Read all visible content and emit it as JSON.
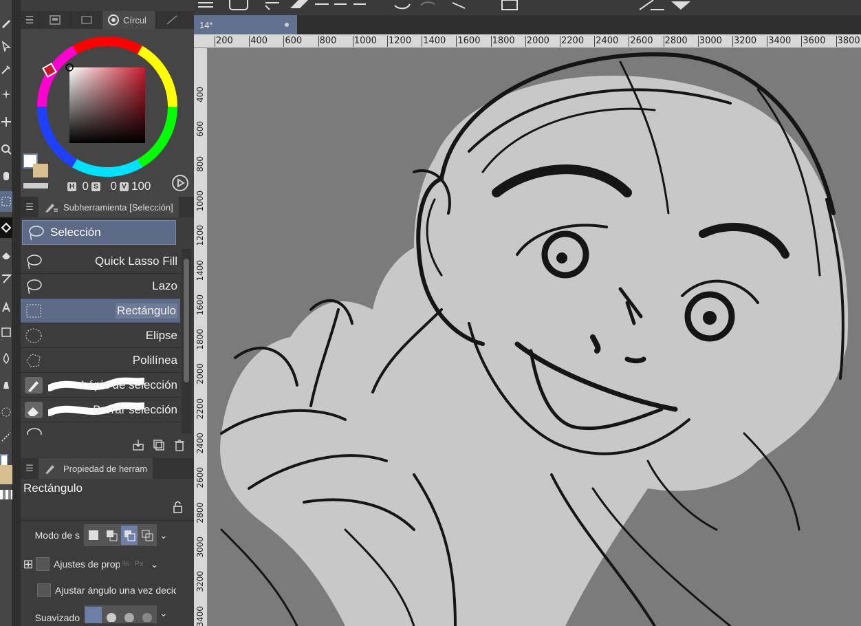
{
  "color_panel": {
    "tab_label": "Círcul",
    "hsv": {
      "h_label": "H",
      "h_value": "0",
      "s_label": "S",
      "s_value": "0",
      "v_label": "V",
      "v_value": "100"
    },
    "colors": {
      "main": "#ffffff",
      "sub": "#d8be8f",
      "hue": "#c51b2c"
    }
  },
  "subtool": {
    "panel_title": "Subherramienta [Selección]",
    "group_label": "Selección",
    "items": [
      {
        "label": "Quick Lasso Fill"
      },
      {
        "label": "Lazo"
      },
      {
        "label": "Rectángulo"
      },
      {
        "label": "Elipse"
      },
      {
        "label": "Polilínea"
      },
      {
        "label": "Lápiz de selección"
      },
      {
        "label": "Borrar selección"
      }
    ]
  },
  "tool_property": {
    "panel_title": "Propiedad de herram",
    "tool_name": "Rectángulo",
    "rows": [
      {
        "label": "Modo de s"
      },
      {
        "label": "Ajustes de propi"
      },
      {
        "label": "Ajustar ángulo una vez decidi"
      },
      {
        "label": "Suavizado"
      }
    ]
  },
  "document": {
    "tab_title": "14*"
  },
  "ruler": {
    "horizontal_ticks": [
      "200",
      "400",
      "600",
      "800",
      "1000",
      "1200",
      "1400",
      "1600",
      "1800",
      "2000",
      "2200",
      "2400",
      "2600",
      "2800",
      "3000",
      "3200",
      "3400",
      "3600",
      "3800"
    ],
    "vertical_ticks": [
      "400",
      "600",
      "800",
      "1000",
      "1200",
      "1400",
      "1600",
      "1800",
      "2000",
      "2200",
      "2400",
      "2600",
      "2800",
      "3000",
      "3200",
      "3400"
    ]
  },
  "canvas": {
    "background": "#7b7b7b",
    "sketch_fill": "#c8c8c8",
    "stroke": "#151515"
  }
}
